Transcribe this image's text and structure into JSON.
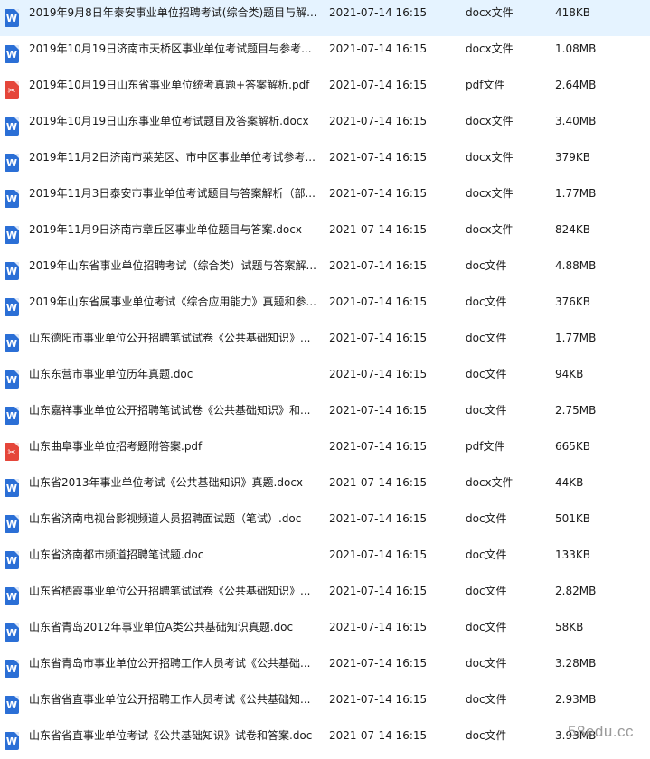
{
  "files": [
    {
      "name": "2019年9月8日年泰安事业单位招聘考试(综合类)题目与解...",
      "date": "2021-07-14 16:15",
      "type": "docx文件",
      "size": "418KB",
      "icon": "word-icon"
    },
    {
      "name": "2019年10月19日济南市天桥区事业单位考试题目与参考...",
      "date": "2021-07-14 16:15",
      "type": "docx文件",
      "size": "1.08MB",
      "icon": "word-icon"
    },
    {
      "name": "2019年10月19日山东省事业单位统考真题+答案解析.pdf",
      "date": "2021-07-14 16:15",
      "type": "pdf文件",
      "size": "2.64MB",
      "icon": "pdf-icon"
    },
    {
      "name": "2019年10月19日山东事业单位考试题目及答案解析.docx",
      "date": "2021-07-14 16:15",
      "type": "docx文件",
      "size": "3.40MB",
      "icon": "word-icon"
    },
    {
      "name": "2019年11月2日济南市莱芜区、市中区事业单位考试参考...",
      "date": "2021-07-14 16:15",
      "type": "docx文件",
      "size": "379KB",
      "icon": "word-icon"
    },
    {
      "name": "2019年11月3日泰安市事业单位考试题目与答案解析（部...",
      "date": "2021-07-14 16:15",
      "type": "docx文件",
      "size": "1.77MB",
      "icon": "word-icon"
    },
    {
      "name": "2019年11月9日济南市章丘区事业单位题目与答案.docx",
      "date": "2021-07-14 16:15",
      "type": "docx文件",
      "size": "824KB",
      "icon": "word-icon"
    },
    {
      "name": "2019年山东省事业单位招聘考试（综合类）试题与答案解...",
      "date": "2021-07-14 16:15",
      "type": "doc文件",
      "size": "4.88MB",
      "icon": "word-icon"
    },
    {
      "name": "2019年山东省属事业单位考试《综合应用能力》真题和参...",
      "date": "2021-07-14 16:15",
      "type": "doc文件",
      "size": "376KB",
      "icon": "word-icon"
    },
    {
      "name": "山东德阳市事业单位公开招聘笔试试卷《公共基础知识》...",
      "date": "2021-07-14 16:15",
      "type": "doc文件",
      "size": "1.77MB",
      "icon": "word-icon"
    },
    {
      "name": "山东东营市事业单位历年真题.doc",
      "date": "2021-07-14 16:15",
      "type": "doc文件",
      "size": "94KB",
      "icon": "word-icon"
    },
    {
      "name": "山东嘉祥事业单位公开招聘笔试试卷《公共基础知识》和...",
      "date": "2021-07-14 16:15",
      "type": "doc文件",
      "size": "2.75MB",
      "icon": "word-icon"
    },
    {
      "name": "山东曲阜事业单位招考题附答案.pdf",
      "date": "2021-07-14 16:15",
      "type": "pdf文件",
      "size": "665KB",
      "icon": "pdf-icon"
    },
    {
      "name": "山东省2013年事业单位考试《公共基础知识》真题.docx",
      "date": "2021-07-14 16:15",
      "type": "docx文件",
      "size": "44KB",
      "icon": "word-icon"
    },
    {
      "name": "山东省济南电视台影视频道人员招聘面试题（笔试）.doc",
      "date": "2021-07-14 16:15",
      "type": "doc文件",
      "size": "501KB",
      "icon": "word-icon"
    },
    {
      "name": "山东省济南都市频道招聘笔试题.doc",
      "date": "2021-07-14 16:15",
      "type": "doc文件",
      "size": "133KB",
      "icon": "word-icon"
    },
    {
      "name": "山东省栖霞事业单位公开招聘笔试试卷《公共基础知识》...",
      "date": "2021-07-14 16:15",
      "type": "doc文件",
      "size": "2.82MB",
      "icon": "word-icon"
    },
    {
      "name": "山东省青岛2012年事业单位A类公共基础知识真题.doc",
      "date": "2021-07-14 16:15",
      "type": "doc文件",
      "size": "58KB",
      "icon": "word-icon"
    },
    {
      "name": "山东省青岛市事业单位公开招聘工作人员考试《公共基础...",
      "date": "2021-07-14 16:15",
      "type": "doc文件",
      "size": "3.28MB",
      "icon": "word-icon"
    },
    {
      "name": "山东省省直事业单位公开招聘工作人员考试《公共基础知...",
      "date": "2021-07-14 16:15",
      "type": "doc文件",
      "size": "2.93MB",
      "icon": "word-icon"
    },
    {
      "name": "山东省省直事业单位考试《公共基础知识》试卷和答案.doc",
      "date": "2021-07-14 16:15",
      "type": "doc文件",
      "size": "3.93MB",
      "icon": "word-icon"
    }
  ],
  "icon_glyphs": {
    "word": "W",
    "pdf": "✂"
  },
  "colors": {
    "word_icon": "#2b6fd6",
    "pdf_icon": "#e5463a",
    "hover": "#e5f3ff"
  },
  "watermark": "58edu.cc"
}
